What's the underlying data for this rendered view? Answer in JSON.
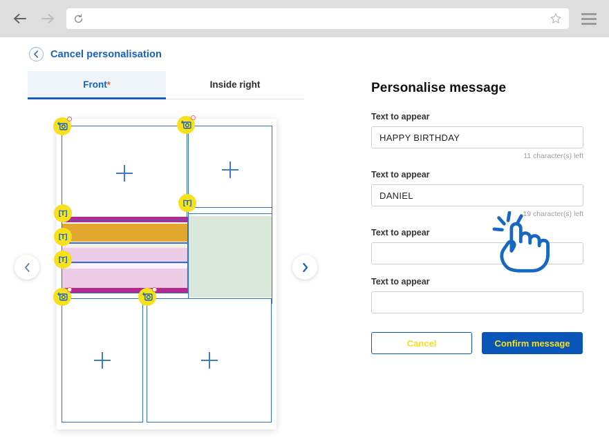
{
  "browser": {
    "back_icon": "arrow-left-icon",
    "forward_icon": "arrow-right-icon",
    "reload_icon": "reload-icon",
    "url_value": "",
    "url_placeholder": "",
    "bookmark_icon": "star-icon",
    "menu_icon": "hamburger-menu-icon"
  },
  "header": {
    "back_icon": "chevron-left-icon",
    "back_label": "Cancel personalisation"
  },
  "tabs": [
    {
      "label": "Front",
      "required_marker": "*",
      "active": true
    },
    {
      "label": "Inside right",
      "required_marker": "",
      "active": false
    }
  ],
  "preview": {
    "prev_arrow_icon": "chevron-left-icon",
    "next_arrow_icon": "chevron-right-icon",
    "badges": [
      {
        "type": "photo",
        "icon": "add-photo-icon",
        "label": "",
        "has_alert": true
      },
      {
        "type": "photo",
        "icon": "add-photo-icon",
        "label": "",
        "has_alert": true
      },
      {
        "type": "text",
        "icon": "text-field-icon",
        "label": "[T]",
        "has_alert": false
      },
      {
        "type": "text",
        "icon": "text-field-icon",
        "label": "[T]",
        "has_alert": false
      },
      {
        "type": "text",
        "icon": "text-field-icon",
        "label": "[T]",
        "has_alert": false
      },
      {
        "type": "text",
        "icon": "text-field-icon",
        "label": "[T]",
        "has_alert": false
      },
      {
        "type": "photo",
        "icon": "add-photo-icon",
        "label": "",
        "has_alert": true
      },
      {
        "type": "photo",
        "icon": "add-photo-icon",
        "label": "",
        "has_alert": true
      }
    ],
    "placeholder_icon": "plus-icon",
    "colors": {
      "zone_border": "#2f6fc4",
      "badge_bg": "#f7e01c",
      "alert_dot": "#f06a4d",
      "stripe_magenta": "#b42a8e",
      "stripe_orange": "#e3a830",
      "stripe_pink": "#eccce6",
      "stripe_cream": "#f5f0e2",
      "art_green": "#d9e8da"
    }
  },
  "form": {
    "title": "Personalise message",
    "fields": [
      {
        "label": "Text to appear",
        "value": "HAPPY BIRTHDAY",
        "placeholder": "",
        "counter": "11 character(s) left"
      },
      {
        "label": "Text to appear",
        "value": "DANIEL",
        "placeholder": "",
        "counter": "19 character(s) left"
      },
      {
        "label": "Text to appear",
        "value": "",
        "placeholder": "",
        "counter": ""
      },
      {
        "label": "Text to appear",
        "value": "",
        "placeholder": "",
        "counter": ""
      }
    ],
    "cancel_label": "Cancel",
    "confirm_label": "Confirm message",
    "accent_color": "#0a56b8",
    "button_text_color": "#f7e01c"
  },
  "cursor": {
    "icon": "click-hand-cursor",
    "color": "#1668c2"
  }
}
